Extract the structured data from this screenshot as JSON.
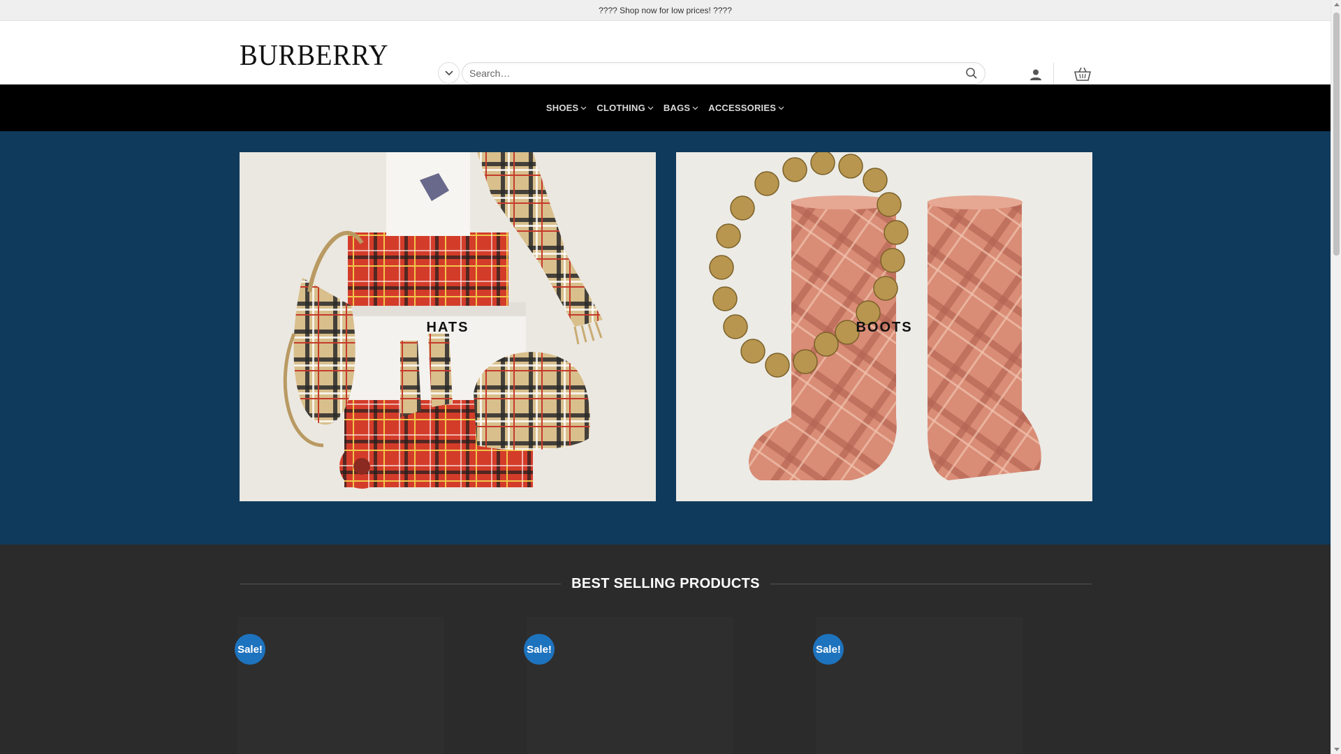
{
  "topbar": {
    "message": "???? Shop now for low prices! ????"
  },
  "header": {
    "logo_text": "BURBERRY",
    "search_placeholder": "Search…",
    "icons": {
      "category": "chevron-down-icon",
      "search": "search-icon",
      "account": "user-icon",
      "cart": "basket-icon"
    }
  },
  "nav": {
    "items": [
      {
        "label": "SHOES"
      },
      {
        "label": "CLOTHING"
      },
      {
        "label": "BAGS"
      },
      {
        "label": "ACCESSORIES"
      }
    ]
  },
  "banner": {
    "tiles": [
      {
        "label": "HATS"
      },
      {
        "label": "BOOTS"
      }
    ]
  },
  "best_selling": {
    "title": "BEST SELLING PRODUCTS",
    "products": [
      {
        "badge": "Sale!"
      },
      {
        "badge": "Sale!"
      },
      {
        "badge": "Sale!"
      }
    ]
  },
  "colors": {
    "banner_bg": "#0f3a5c",
    "nav_bg": "#000000",
    "section_bg": "#2b2b2b",
    "sale_badge": "#1e73be"
  }
}
